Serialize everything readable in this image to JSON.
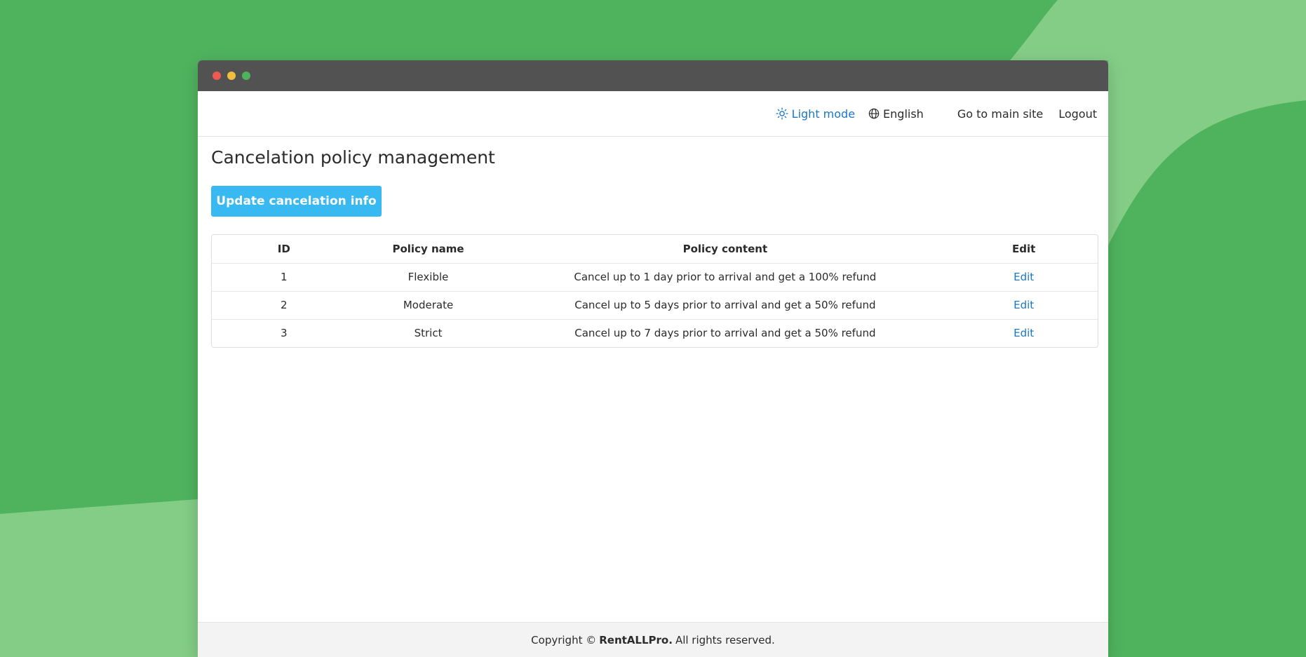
{
  "colors": {
    "background": "#4fb35e",
    "background_light": "#84cd87",
    "titlebar": "#525252",
    "accent_link": "#1a76c9",
    "button": "#38b9f1",
    "traffic_red": "#ee5a52",
    "traffic_yellow": "#f1be3f",
    "traffic_green": "#4fb35e"
  },
  "nav": {
    "theme_label": "Light mode",
    "theme_icon": "sun-icon",
    "language_label": "English",
    "language_icon": "globe-icon",
    "main_site_label": "Go to main site",
    "logout_label": "Logout"
  },
  "page": {
    "title": "Cancelation policy management",
    "update_button_label": "Update cancelation info"
  },
  "table": {
    "headers": [
      "ID",
      "Policy name",
      "Policy content",
      "Edit"
    ],
    "rows": [
      {
        "id": "1",
        "name": "Flexible",
        "content": "Cancel up to 1 day prior to arrival and get a 100% refund",
        "edit": "Edit"
      },
      {
        "id": "2",
        "name": "Moderate",
        "content": "Cancel up to 5 days prior to arrival and get a 50% refund",
        "edit": "Edit"
      },
      {
        "id": "3",
        "name": "Strict",
        "content": "Cancel up to 7 days prior to arrival and get a 50% refund",
        "edit": "Edit"
      }
    ]
  },
  "footer": {
    "prefix": "Copyright ©",
    "brand": "RentALLPro.",
    "suffix": "All rights reserved."
  }
}
